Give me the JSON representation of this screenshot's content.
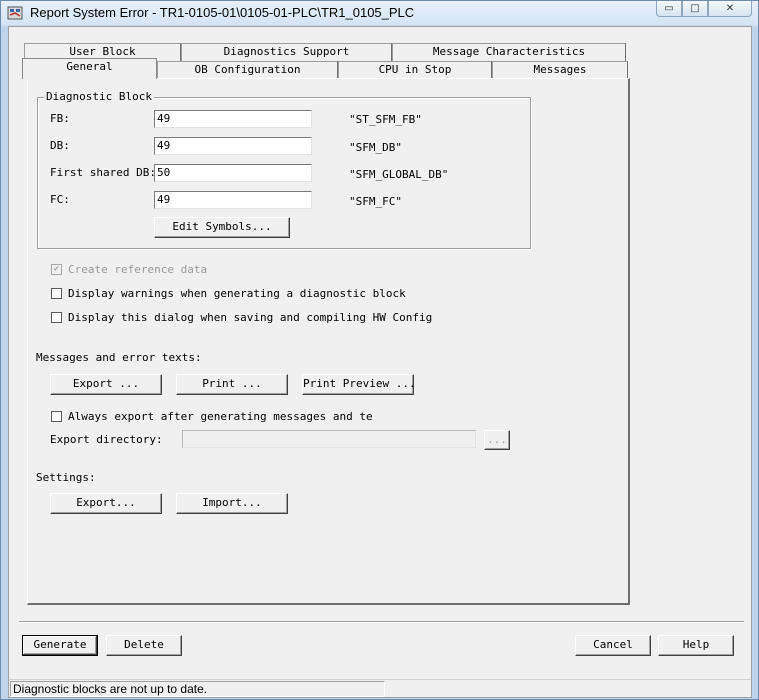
{
  "window": {
    "title": "Report System Error - TR1-0105-01\\0105-01-PLC\\TR1_0105_PLC",
    "minimize_glyph": "▭",
    "maximize_glyph": "□",
    "close_glyph": "✕"
  },
  "tabs": {
    "row_back": [
      {
        "label": "User Block"
      },
      {
        "label": "Diagnostics Support"
      },
      {
        "label": "Message Characteristics"
      }
    ],
    "row_front": [
      {
        "label": "General",
        "selected": true
      },
      {
        "label": "OB Configuration"
      },
      {
        "label": "CPU in Stop"
      },
      {
        "label": "Messages"
      }
    ]
  },
  "diagnostic_block": {
    "title": "Diagnostic Block",
    "rows": [
      {
        "label": "FB:",
        "value": "49",
        "symbol": "\"ST_SFM_FB\""
      },
      {
        "label": "DB:",
        "value": "49",
        "symbol": "\"SFM_DB\""
      },
      {
        "label": "First shared DB:",
        "value": "50",
        "symbol": "\"SFM_GLOBAL_DB\""
      },
      {
        "label": "FC:",
        "value": "49",
        "symbol": "\"SFM_FC\""
      }
    ],
    "edit_symbols_label": "Edit Symbols..."
  },
  "options": {
    "create_reference": {
      "label": "Create reference data",
      "checked": true,
      "enabled": false
    },
    "display_warnings": {
      "label": "Display warnings when generating a diagnostic block",
      "checked": false
    },
    "display_dialog": {
      "label": "Display this dialog when saving and compiling HW Config",
      "checked": false
    }
  },
  "messages": {
    "heading": "Messages and error texts:",
    "export_label": "Export ...",
    "print_label": "Print ...",
    "print_preview_label": "Print Preview ...",
    "always_export_label": "Always export after generating messages and te",
    "export_directory_label": "Export directory:",
    "export_directory_value": "",
    "browse_label": "..."
  },
  "settings": {
    "heading": "Settings:",
    "export_label": "Export...",
    "import_label": "Import..."
  },
  "footer": {
    "generate_label": "Generate",
    "delete_label": "Delete",
    "cancel_label": "Cancel",
    "help_label": "Help"
  },
  "status": {
    "text": "Diagnostic blocks are not up to date."
  }
}
